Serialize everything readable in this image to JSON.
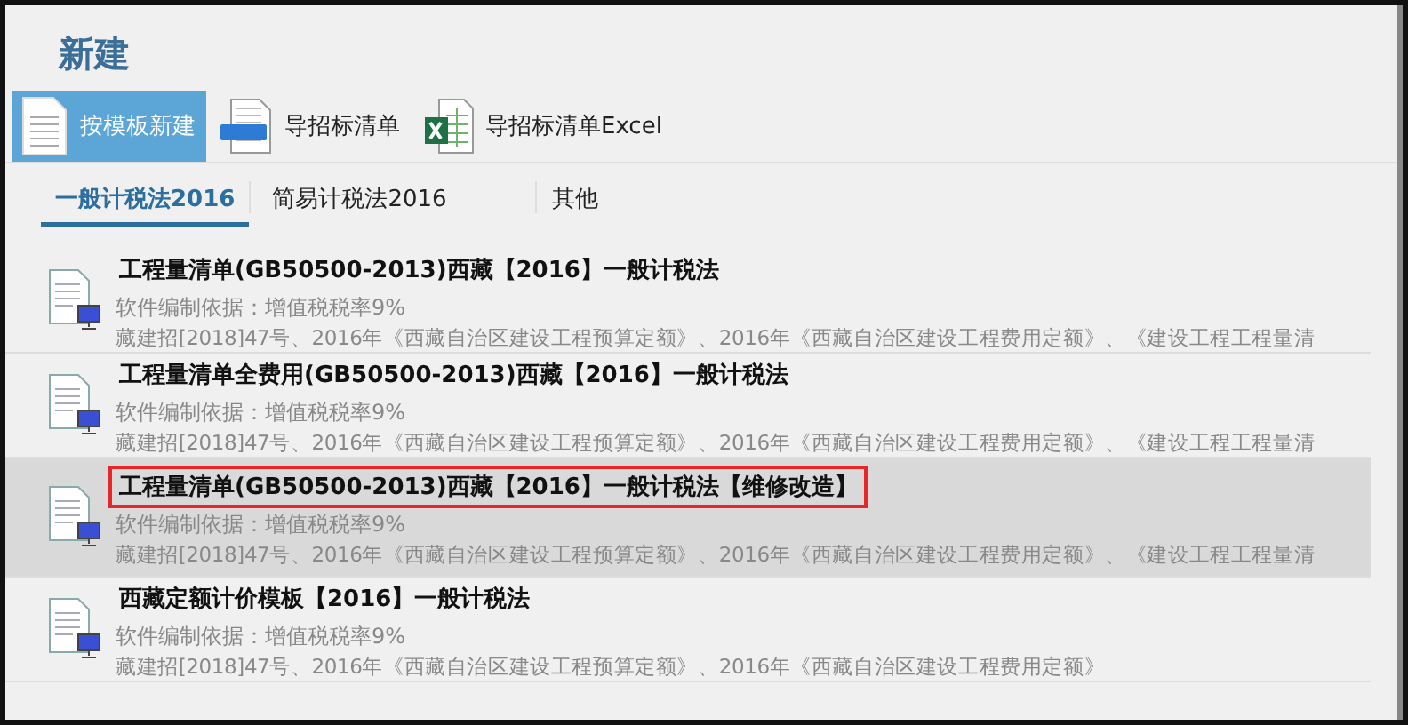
{
  "window": {
    "title": "新建"
  },
  "toolbar": [
    {
      "label": "按模板新建",
      "kind": "template",
      "selected": true
    },
    {
      "label": "导招标清单",
      "kind": "xml",
      "selected": false
    },
    {
      "label": "导招标清单Excel",
      "kind": "excel",
      "selected": false
    }
  ],
  "tabs": [
    {
      "label": "一般计税法2016",
      "selected": true
    },
    {
      "label": "简易计税法2016",
      "selected": false
    },
    {
      "label": "其他",
      "selected": false
    }
  ],
  "templates": [
    {
      "title": "工程量清单(GB50500-2013)西藏【2016】一般计税法",
      "basis": "软件编制依据：增值税税率9%",
      "references": "藏建招[2018]47号、2016年《西藏自治区建设工程预算定额》、2016年《西藏自治区建设工程费用定额》、《建设工程工程量清",
      "selected": false,
      "outlined": false
    },
    {
      "title": "工程量清单全费用(GB50500-2013)西藏【2016】一般计税法",
      "basis": "软件编制依据：增值税税率9%",
      "references": "藏建招[2018]47号、2016年《西藏自治区建设工程预算定额》、2016年《西藏自治区建设工程费用定额》、《建设工程工程量清",
      "selected": false,
      "outlined": false
    },
    {
      "title": "工程量清单(GB50500-2013)西藏【2016】一般计税法【维修改造】",
      "basis": "软件编制依据：增值税税率9%",
      "references": "藏建招[2018]47号、2016年《西藏自治区建设工程预算定额》、2016年《西藏自治区建设工程费用定额》、《建设工程工程量清",
      "selected": true,
      "outlined": true
    },
    {
      "title": "西藏定额计价模板【2016】一般计税法",
      "basis": "软件编制依据：增值税税率9%",
      "references": "藏建招[2018]47号、2016年《西藏自治区建设工程预算定额》、2016年《西藏自治区建设工程费用定额》",
      "selected": false,
      "outlined": false
    }
  ]
}
